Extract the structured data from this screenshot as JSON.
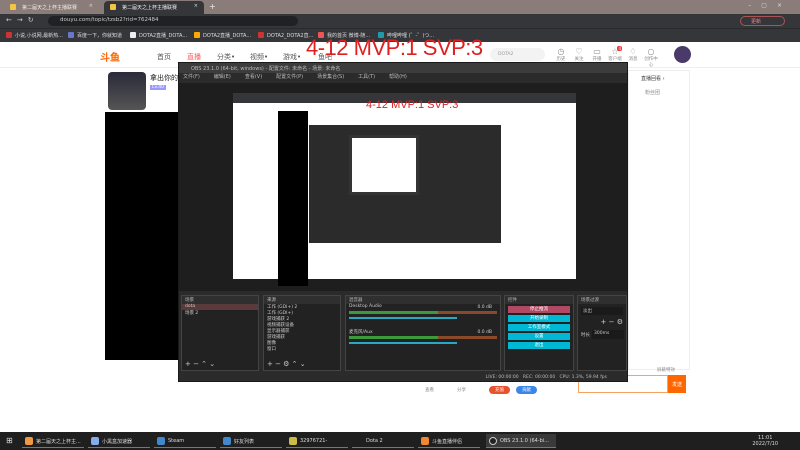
{
  "browser": {
    "tabs": [
      {
        "title": "第二届天之上杯主播联赛"
      },
      {
        "title": "第二届天之上杯主播联赛"
      }
    ],
    "url": "douyu.com/topic/tzsb2?rid=762484",
    "update_button": "更新",
    "bookmarks": [
      "小说,小说网,最新热...",
      "百度一下，你就知道",
      "DOTA2直播_DOTA...",
      "DOTA2直播_DOTA...",
      "DOTA2_DOTA2直...",
      "我的首页 微博-随...",
      "哔哩哔哩 (゜-゜)つ..."
    ]
  },
  "site": {
    "logo": "斗鱼",
    "nav": [
      "首页",
      "直播",
      "分类•",
      "视频•",
      "游戏•",
      "鱼吧"
    ],
    "search_placeholder": "DOTA2",
    "header_icons": [
      "历史",
      "关注",
      "开播",
      "客户端",
      "消息",
      "创作中心"
    ],
    "message_badge": "4",
    "streamer_title": "拿出你的",
    "streamer_badge": "Lv.40",
    "right_links": [
      "直播回看 ›",
      "粉丝团"
    ],
    "bottom": [
      "查看",
      "分享",
      "充值",
      "贡献"
    ],
    "chat_checkbox": "屏蔽特效",
    "send": "发送"
  },
  "overlay": "4-12 MVP:1 SVP:3",
  "nested_overlay": "4-12 MVP:1 SVP:3",
  "obs": {
    "title": "OBS 23.1.0 (64-bit, windows) - 配置文件: 未命名 - 场景: 未命名",
    "menu": [
      "文件(F)",
      "编辑(E)",
      "查看(V)",
      "配置文件(P)",
      "场景集合(S)",
      "工具(T)",
      "帮助(H)"
    ],
    "panels": {
      "scenes": "场景",
      "sources": "来源",
      "mixer": "混音器",
      "controls": "控件",
      "transitions": "场景过渡"
    },
    "scenes": [
      "dota",
      "场景 2"
    ],
    "sources": [
      "工作 (GDI+) 2",
      "工作 (GDI+)",
      "游戏捕获 2",
      "视频捕获设备",
      "显示器捕获",
      "游戏捕获",
      "图像",
      "窗口"
    ],
    "mixer": [
      {
        "name": "Desktop Audio",
        "db": "0.0 dB"
      },
      {
        "name": "麦克风/Aux",
        "db": "0.0 dB"
      }
    ],
    "controls": [
      "停止推流",
      "开始录制",
      "工作室模式",
      "设置",
      "退出"
    ],
    "transition": "淡出",
    "duration_label": "时长",
    "duration": "300ms",
    "status": {
      "live": "LIVE: 00:00:00",
      "rec": "REC: 00:00:00",
      "cpu": "CPU: 1.3%, 59.94 fps"
    }
  },
  "taskbar": {
    "items": [
      "第二届天之上杯主...",
      "小黑盒加速器",
      "Steam",
      "好友列表",
      "32976721-",
      "Dota 2",
      "斗鱼直播伴侣",
      "OBS 23.1.0 (64-bi..."
    ],
    "time": "11:01",
    "date": "2022/7/10"
  }
}
